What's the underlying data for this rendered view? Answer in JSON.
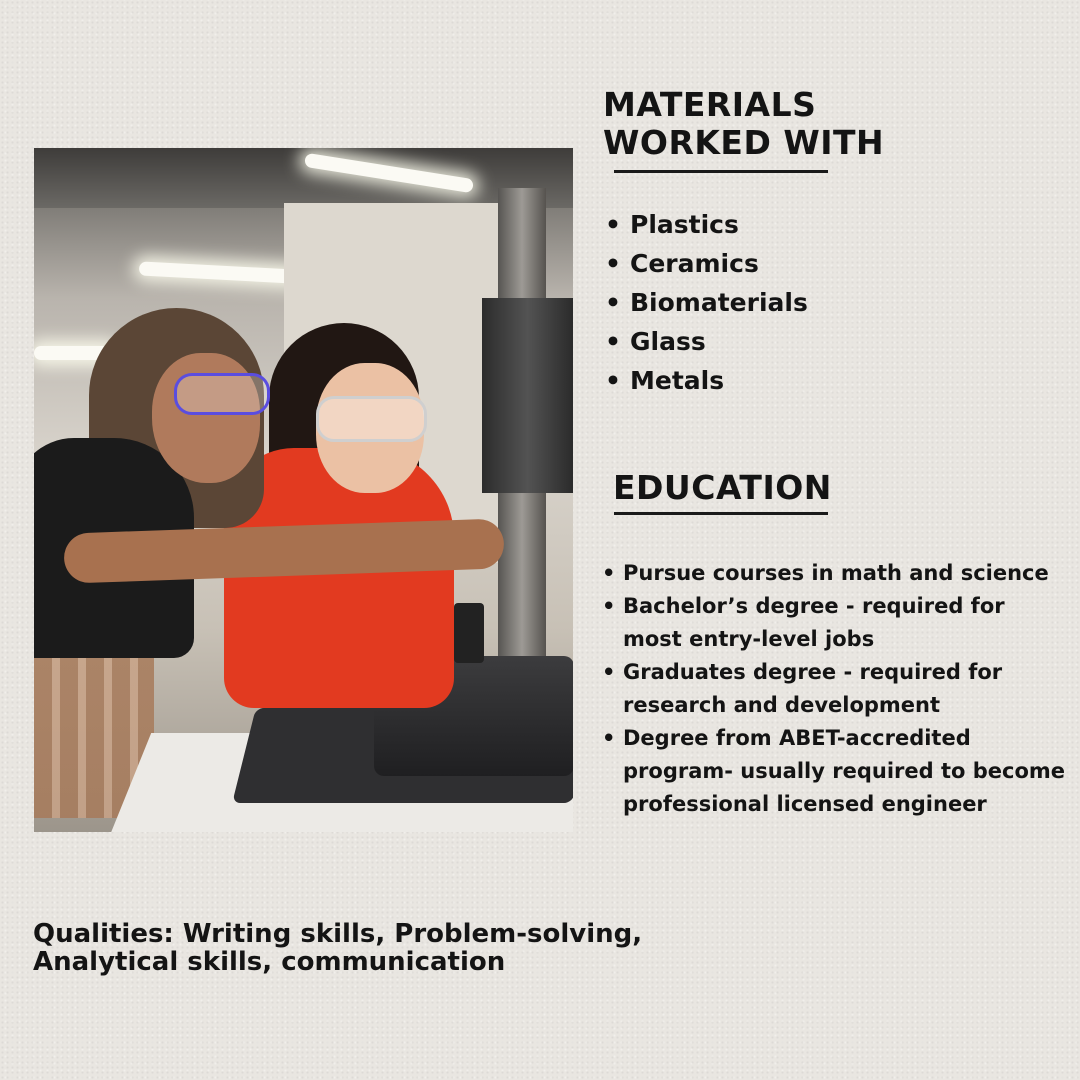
{
  "photo": {
    "subject": "Two women wearing safety goggles operating laboratory equipment"
  },
  "materials": {
    "heading": "MATERIALS WORKED WITH",
    "items": [
      "Plastics",
      "Ceramics",
      "Biomaterials",
      "Glass",
      "Metals"
    ]
  },
  "education": {
    "heading": "EDUCATION",
    "items": [
      "Pursue courses in math and science",
      "Bachelor’s degree - required for most entry-level jobs",
      "Graduates degree - required for research and development",
      "Degree from ABET-accredited program- usually required to become professional licensed engineer"
    ]
  },
  "qualities": {
    "text": "Qualities: Writing skills, Problem-solving, Analytical skills, communication"
  },
  "colors": {
    "background": "#e9e6e1",
    "text": "#141414",
    "accent_shirt": "#e23a20"
  }
}
